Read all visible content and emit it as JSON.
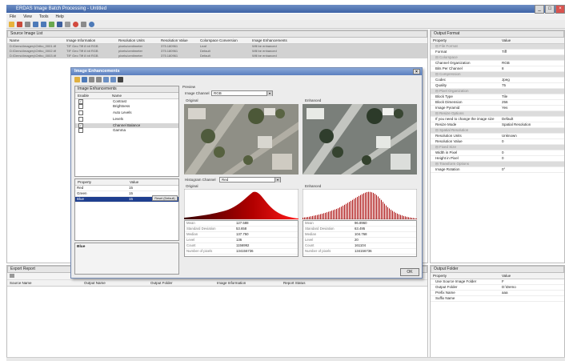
{
  "app": {
    "title": "ERDAS Image Batch Processing - Untitled"
  },
  "menu": [
    "File",
    "View",
    "Tools",
    "Help"
  ],
  "source_panel": {
    "title": "Source Image List",
    "columns": [
      "Name",
      "Image Information",
      "Resolution Units",
      "Resolution Value",
      "Colorspace Conversion",
      "Image Enhancements"
    ],
    "rows": [
      [
        "D:\\Demo\\Imagery\\Ortho_0001.tif",
        "TIF Geo Tiff 8 bit RGB",
        "pixels/centimeter",
        "375.180961",
        "Leaf",
        "Will be enhanced"
      ],
      [
        "D:\\Demo\\Imagery\\Ortho_0002.tif",
        "TIF Geo Tiff 8 bit RGB",
        "pixels/centimeter",
        "375.180961",
        "Default",
        "Will be enhanced"
      ],
      [
        "D:\\Demo\\Imagery\\Ortho_0003.tif",
        "TIF Geo Tiff 8 bit RGB",
        "pixels/centimeter",
        "375.180961",
        "Default",
        "Will be enhanced"
      ]
    ]
  },
  "output_format": {
    "title": "Output Format",
    "header": [
      "Property",
      "Value"
    ],
    "rows": [
      {
        "k": "File Format",
        "v": "",
        "cat": true
      },
      {
        "k": "Format",
        "v": "Tiff",
        "cat": false
      },
      {
        "k": "Colorspace",
        "v": "",
        "cat": true
      },
      {
        "k": "Channel Organization",
        "v": "RGB",
        "cat": false
      },
      {
        "k": "Bits Per Channel",
        "v": "8",
        "cat": false
      },
      {
        "k": "Compression",
        "v": "",
        "cat": true
      },
      {
        "k": "Codec",
        "v": "Jpeg",
        "cat": false
      },
      {
        "k": "Quality",
        "v": "75",
        "cat": false
      },
      {
        "k": "Pixel Organization",
        "v": "",
        "cat": true
      },
      {
        "k": "Block Type",
        "v": "Tile",
        "cat": false
      },
      {
        "k": "Block Dimension",
        "v": "256",
        "cat": false
      },
      {
        "k": "Image Pyramid",
        "v": "Yes",
        "cat": false
      },
      {
        "k": "Resize Options",
        "v": "",
        "cat": true
      },
      {
        "k": "If you need to change the image size",
        "v": "Default",
        "cat": false
      },
      {
        "k": "Resize Mode",
        "v": "Spatial Resolution",
        "cat": false
      },
      {
        "k": "Spatial Resolution",
        "v": "",
        "cat": true
      },
      {
        "k": "Resolution Units",
        "v": "Unknown",
        "cat": false
      },
      {
        "k": "Resolution Value",
        "v": "0",
        "cat": false
      },
      {
        "k": "Fixed Size",
        "v": "",
        "cat": true
      },
      {
        "k": "Width in Pixel",
        "v": "0",
        "cat": false
      },
      {
        "k": "Height in Pixel",
        "v": "0",
        "cat": false
      },
      {
        "k": "Transform Options",
        "v": "",
        "cat": true
      },
      {
        "k": "Image Rotation",
        "v": "0°",
        "cat": false
      }
    ]
  },
  "output_folder": {
    "title": "Output Folder",
    "header": [
      "Property",
      "Value"
    ],
    "rows": [
      {
        "k": "Use Source Image Folder",
        "v": "F"
      },
      {
        "k": "Output Folder",
        "v": "D:\\Demo"
      },
      {
        "k": "Prefix Name",
        "v": "aaa"
      },
      {
        "k": "Suffix Name",
        "v": ""
      }
    ]
  },
  "export_report": {
    "title": "Export Report",
    "columns": [
      "Source Name",
      "Output Name",
      "Output Folder",
      "Image Information",
      "Report Status"
    ]
  },
  "dialog": {
    "title": "Image Enhancements",
    "enh_title": "Image Enhancements",
    "enh_cols": [
      "Enable",
      "Name"
    ],
    "enhancements": [
      {
        "name": "Contrast",
        "checked": true,
        "selected": false
      },
      {
        "name": "Brightness",
        "checked": false,
        "selected": false
      },
      {
        "name": "Auto Levels",
        "checked": false,
        "selected": false
      },
      {
        "name": "Levels",
        "checked": false,
        "selected": false
      },
      {
        "name": "Channel Balance",
        "checked": true,
        "selected": true
      },
      {
        "name": "Gamma",
        "checked": false,
        "selected": false
      }
    ],
    "prop_cols": [
      "Property",
      "Value"
    ],
    "props": [
      {
        "k": "Red",
        "v": "15",
        "sel": false
      },
      {
        "k": "Green",
        "v": "15",
        "sel": false
      },
      {
        "k": "Blue",
        "v": "15",
        "sel": true
      }
    ],
    "reset_label": "Reset (Default)",
    "desc": "Blue",
    "preview_label": "Preview",
    "image_channel_label": "Image Channel",
    "image_channel_value": "RGB",
    "original_label": "Original",
    "enhanced_label": "Enhanced",
    "hist_channel_label": "Histogram Channel",
    "hist_channel_value": "Red",
    "stats_left": [
      {
        "k": "Mean",
        "v": "127.588"
      },
      {
        "k": "Standard Deviation",
        "v": "53.658"
      },
      {
        "k": "Median",
        "v": "137.750"
      },
      {
        "k": "Level",
        "v": "136"
      },
      {
        "k": "Count",
        "v": "1156992"
      },
      {
        "k": "Number of pixels",
        "v": "134156736"
      }
    ],
    "stats_right": [
      {
        "k": "Mean",
        "v": "96.8960"
      },
      {
        "k": "Standard Deviation",
        "v": "63.495"
      },
      {
        "k": "Median",
        "v": "104.768"
      },
      {
        "k": "Level",
        "v": "20"
      },
      {
        "k": "Count",
        "v": "161104"
      },
      {
        "k": "Number of pixels",
        "v": "134156736"
      }
    ],
    "ok_label": "OK"
  }
}
